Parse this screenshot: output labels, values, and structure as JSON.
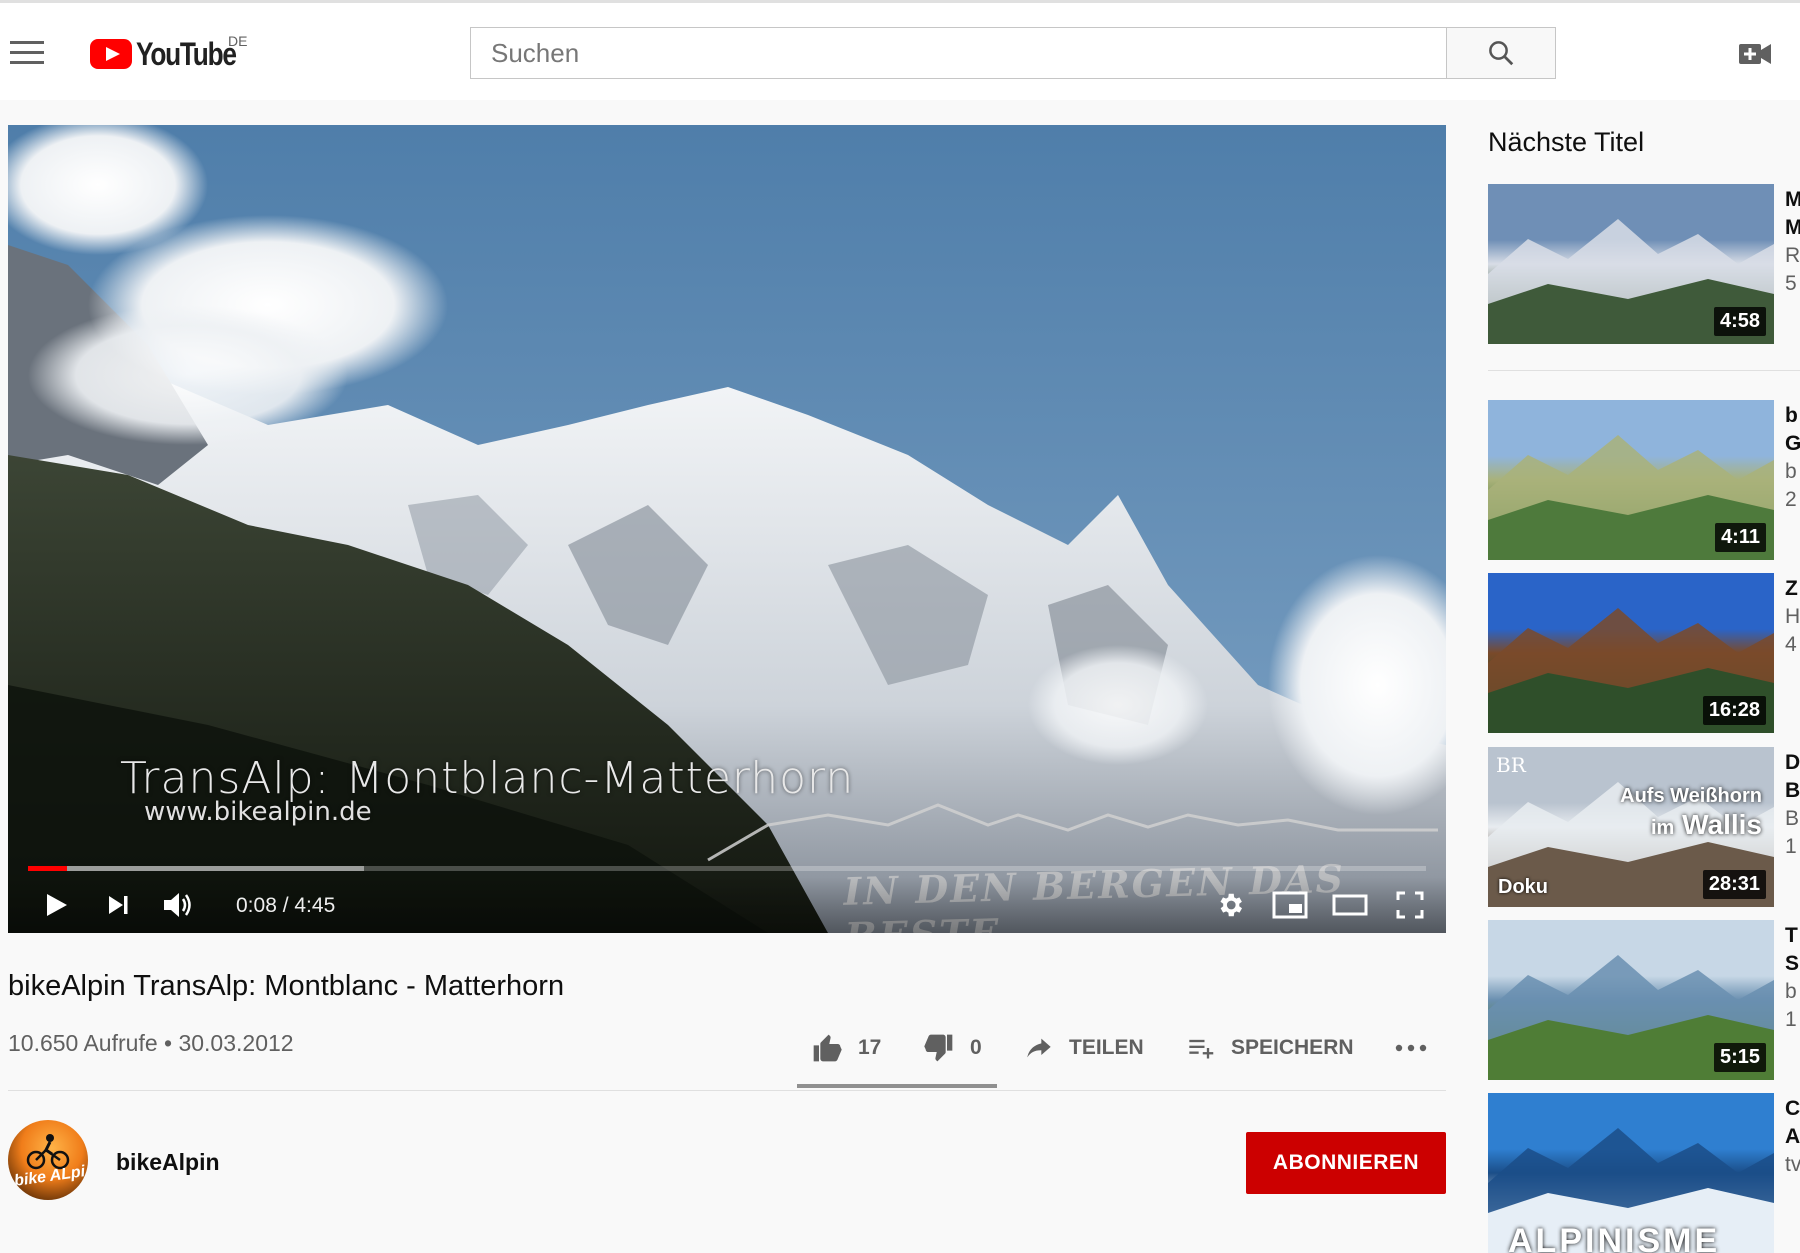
{
  "header": {
    "logo_text": "YouTube",
    "region": "DE",
    "search_placeholder": "Suchen"
  },
  "player": {
    "overlay_title": "TransAlp: Montblanc-Matterhorn",
    "overlay_url": "www.bikealpin.de",
    "overlay_slogan": "IN DEN BERGEN DAS BESTE",
    "time_display": "0:08 / 4:45",
    "progress_played_fraction": 0.028,
    "progress_buffered_fraction": 0.24
  },
  "video": {
    "title": "bikeAlpin TransAlp: Montblanc - Matterhorn",
    "info": "10.650 Aufrufe • 30.03.2012",
    "likes": "17",
    "dislikes": "0",
    "share_label": "TEILEN",
    "save_label": "SPEICHERN"
  },
  "channel": {
    "name": "bikeAlpin",
    "avatar_text": "bike ALpi",
    "subscribe_label": "ABONNIEREN"
  },
  "sidebar": {
    "up_next_label": "Nächste Titel",
    "items": [
      {
        "duration": "4:58",
        "title_lines": [
          "M",
          "M"
        ],
        "meta_lines": [
          "R",
          "5"
        ],
        "colors": [
          "#6f8fb6",
          "#3f5a3a",
          "#d8dde6"
        ]
      },
      {
        "duration": "4:11",
        "title_lines": [
          "b",
          "G"
        ],
        "meta_lines": [
          "b",
          "2"
        ],
        "colors": [
          "#8fb4dc",
          "#4e7a3c",
          "#a9b27a"
        ]
      },
      {
        "duration": "16:28",
        "title_lines": [
          "Z"
        ],
        "meta_lines": [
          "H",
          "4"
        ],
        "colors": [
          "#2a64c8",
          "#2f4f2a",
          "#7a4a2a"
        ]
      },
      {
        "duration": "28:31",
        "tag": "Doku",
        "overlay_line1": "Aufs Weißhorn",
        "overlay_line2a": "im",
        "overlay_line2b": "Wallis",
        "logo": "BR",
        "title_lines": [
          "D",
          "B"
        ],
        "meta_lines": [
          "B",
          "1"
        ],
        "colors": [
          "#b9c3cf",
          "#6b5a4a",
          "#e8ecf0"
        ]
      },
      {
        "duration": "5:15",
        "title_lines": [
          "T",
          "S"
        ],
        "meta_lines": [
          "b",
          "1"
        ],
        "colors": [
          "#c7d7e6",
          "#4f7d36",
          "#6a8fb0"
        ]
      },
      {
        "duration": "",
        "overlay_text": "ALPINISME",
        "title_lines": [
          "C",
          "A"
        ],
        "meta_lines": [
          "tv"
        ],
        "colors": [
          "#2f7fd0",
          "#e6eef6",
          "#1b4e88"
        ]
      }
    ]
  }
}
